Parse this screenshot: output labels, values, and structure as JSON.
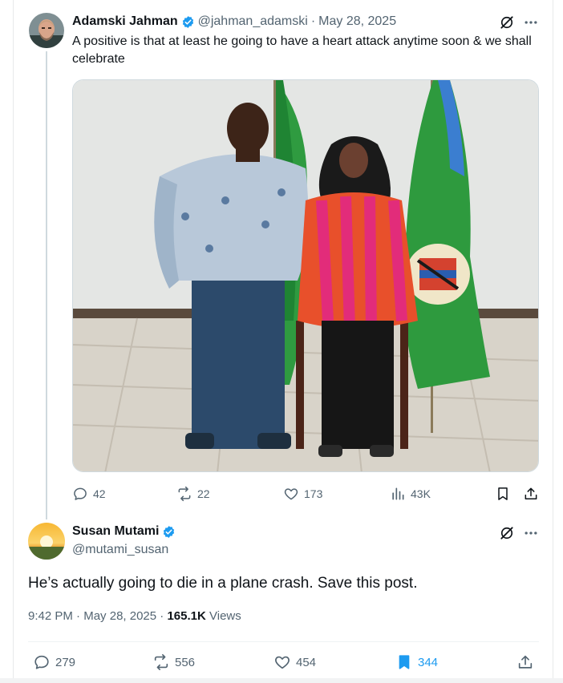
{
  "parent_tweet": {
    "author_name": "Adamski Jahman",
    "author_handle": "@jahman_adamski",
    "separator": "·",
    "date": "May 28, 2025",
    "text": "A positive is that at least he going to have a heart attack anytime soon & we shall celebrate",
    "avatar_icon": "profile-photo",
    "media": "photo",
    "actions": {
      "replies": "42",
      "reposts": "22",
      "likes": "173",
      "views": "43K"
    }
  },
  "main_tweet": {
    "author_name": "Susan Mutami",
    "author_handle": "@mutami_susan",
    "text": "He’s actually going to die in a plane crash. Save this post.",
    "time": "9:42 PM",
    "separator": "·",
    "date": "May 28, 2025",
    "views_count": "165.1K",
    "views_label": "Views",
    "actions": {
      "replies": "279",
      "reposts": "556",
      "likes": "454",
      "bookmarks": "344"
    }
  },
  "colors": {
    "verified_badge": "#1d9bf0",
    "secondary_text": "#536471",
    "bookmark_active": "#1d9bf0",
    "thread_line": "#cfd9de"
  }
}
